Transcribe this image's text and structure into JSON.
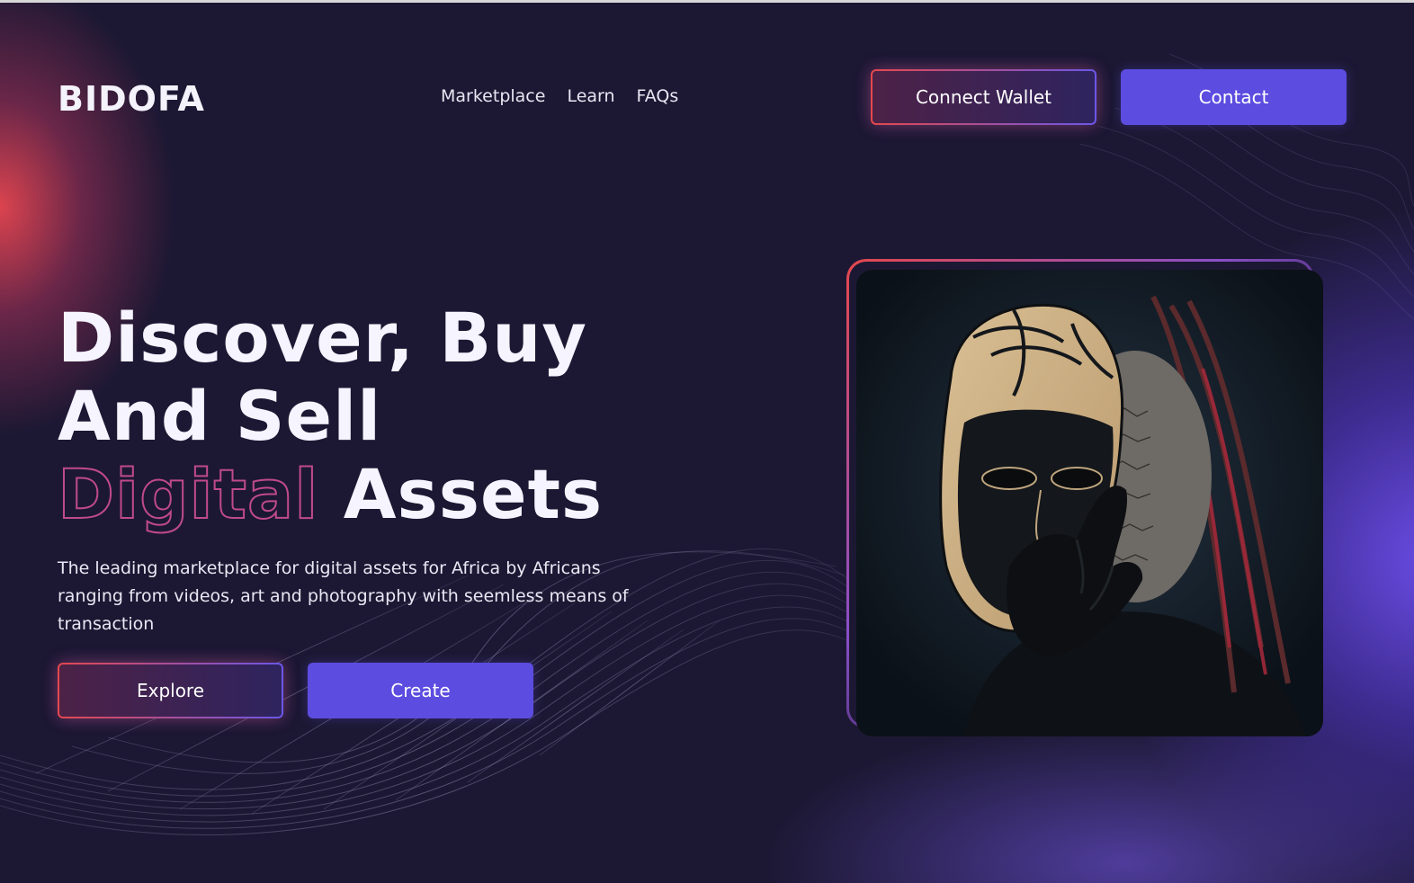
{
  "brand": {
    "logo": "BIDOFA"
  },
  "nav": {
    "items": [
      {
        "label": "Marketplace"
      },
      {
        "label": "Learn"
      },
      {
        "label": "FAQs"
      }
    ]
  },
  "header_actions": {
    "connect_wallet_label": "Connect Wallet",
    "contact_label": "Contact"
  },
  "hero": {
    "headline_line1": "Discover, Buy",
    "headline_line2": "And Sell",
    "headline_outline_word": "Digital",
    "headline_line3_rest": "Assets",
    "description": "The leading marketplace for digital assets for Africa by Africans ranging from videos, art and photography with seemless means of transaction",
    "explore_label": "Explore",
    "create_label": "Create"
  },
  "featured_image": {
    "icon": "masked-face-artwork"
  },
  "colors": {
    "background": "#1c1833",
    "accent_purple": "#5c4ce0",
    "accent_red": "#e5484d",
    "text": "#ffffff"
  }
}
